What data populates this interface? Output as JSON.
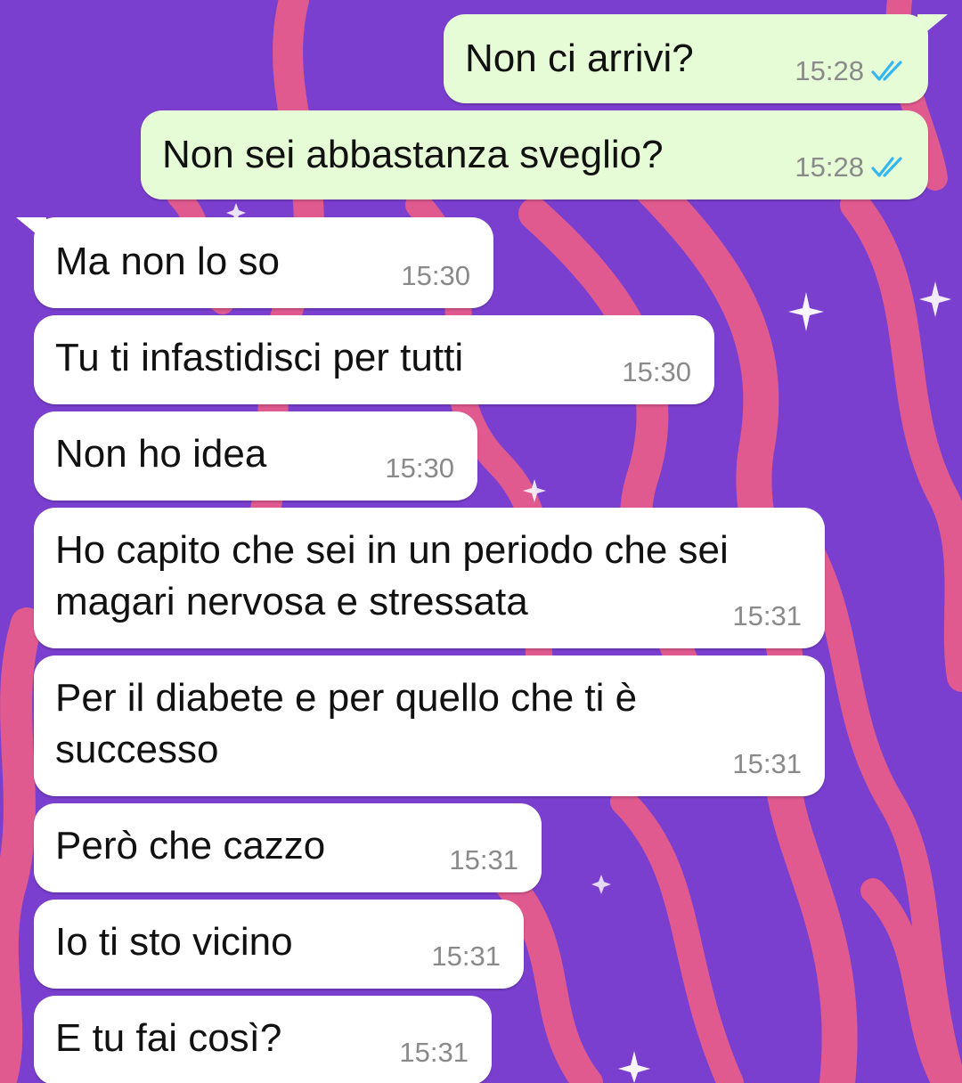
{
  "colors": {
    "wallpaper": "#7b3fd0",
    "flames": "#e05a8f",
    "outgoing_bubble": "#e6fcd7",
    "incoming_bubble": "#ffffff",
    "read_ticks": "#34b7f1",
    "timestamp": "#8a8a8a"
  },
  "messages": [
    {
      "direction": "out",
      "text": "Non ci arrivi?",
      "time": "15:28",
      "status_icon": "double-check-read-icon"
    },
    {
      "direction": "out",
      "text": "Non sei abbastanza sveglio?",
      "time": "15:28",
      "status_icon": "double-check-read-icon"
    },
    {
      "direction": "in",
      "text": "Ma non lo so",
      "time": "15:30"
    },
    {
      "direction": "in",
      "text": "Tu ti infastidisci per tutti",
      "time": "15:30"
    },
    {
      "direction": "in",
      "text": "Non ho idea",
      "time": "15:30"
    },
    {
      "direction": "in",
      "lines": [
        "Ho capito che sei in un periodo che sei",
        "magari nervosa e stressata"
      ],
      "time": "15:31"
    },
    {
      "direction": "in",
      "lines": [
        "Per il diabete e per quello che ti è",
        "successo"
      ],
      "time": "15:31"
    },
    {
      "direction": "in",
      "text": "Però che cazzo",
      "time": "15:31"
    },
    {
      "direction": "in",
      "text": "Io ti sto vicino",
      "time": "15:31"
    },
    {
      "direction": "in",
      "text": "E tu fai così?",
      "time": "15:31"
    }
  ]
}
